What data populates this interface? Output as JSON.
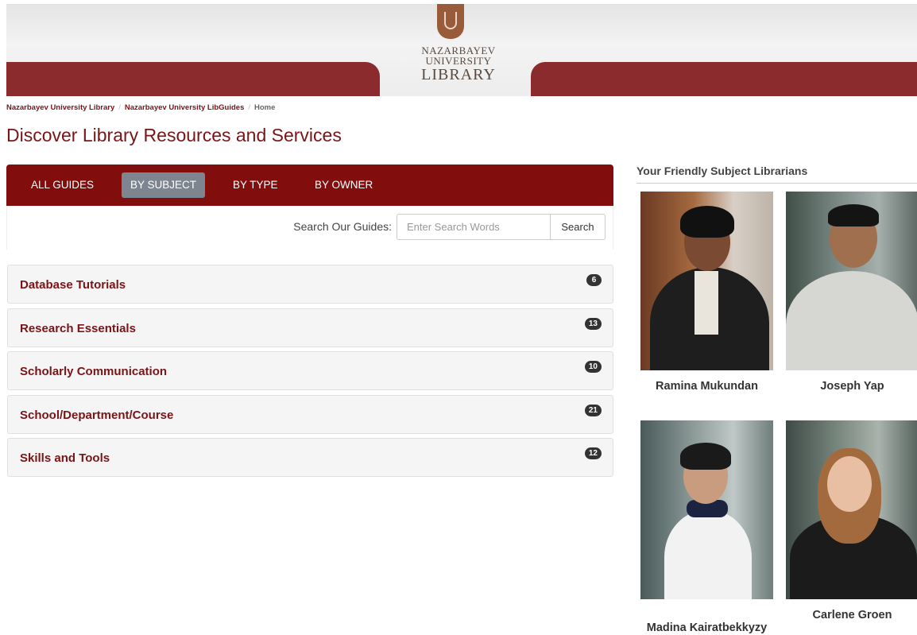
{
  "header": {
    "logo_line1": "NAZARBAYEV",
    "logo_line2": "UNIVERSITY",
    "logo_line3": "LIBRARY",
    "brand_color": "#820d0d"
  },
  "breadcrumb": {
    "items": [
      "Nazarbayev University Library",
      "Nazarbayev University LibGuides"
    ],
    "current": "Home"
  },
  "page_title": "Discover Library Resources and Services",
  "tabs": [
    {
      "label": "ALL GUIDES",
      "active": false
    },
    {
      "label": "BY SUBJECT",
      "active": true
    },
    {
      "label": "BY TYPE",
      "active": false
    },
    {
      "label": "BY OWNER",
      "active": false
    }
  ],
  "search": {
    "label": "Search Our Guides:",
    "placeholder": "Enter Search Words",
    "button": "Search"
  },
  "subjects": [
    {
      "title": "Database Tutorials",
      "count": "6"
    },
    {
      "title": "Research Essentials",
      "count": "13"
    },
    {
      "title": "Scholarly Communication",
      "count": "10"
    },
    {
      "title": "School/Department/Course",
      "count": "21"
    },
    {
      "title": "Skills and Tools",
      "count": "12"
    }
  ],
  "sidebar": {
    "title": "Your Friendly Subject Librarians",
    "librarians": [
      {
        "name": "Ramina Mukundan"
      },
      {
        "name": "Joseph Yap"
      },
      {
        "name": "Madina Kairatbekkyzy"
      },
      {
        "name": "Carlene Groen"
      }
    ]
  }
}
